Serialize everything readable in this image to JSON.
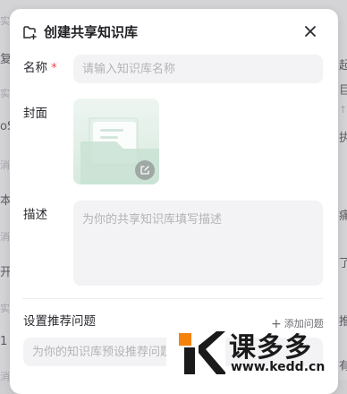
{
  "background": {
    "left_fragments": [
      "实",
      "复",
      "实",
      "oS",
      "消",
      "本",
      "消",
      "开",
      "实",
      "1",
      "消"
    ],
    "right_fragments": [
      "起",
      "巨",
      "↑",
      "执",
      "痛",
      "了",
      "推",
      "有"
    ]
  },
  "dialog": {
    "title": "创建共享知识库",
    "title_icon": "folder-plus-icon",
    "close_icon": "close-icon",
    "name": {
      "label": "名称",
      "required_mark": "*",
      "value": "",
      "placeholder": "请输入知识库名称"
    },
    "cover": {
      "label": "封面",
      "image_icon": "folder-document-icon",
      "edit_icon": "edit-icon"
    },
    "description": {
      "label": "描述",
      "value": "",
      "placeholder": "为你的共享知识库填写描述"
    },
    "recommended_questions": {
      "label": "设置推荐问题",
      "add_icon": "plus-icon",
      "add_label": "添加问题",
      "input_placeholder": "为你的知识库预设推荐问题"
    }
  },
  "watermark": {
    "brand": "课多多",
    "url": "www.kedd.cn",
    "brand_color": "#f5820a"
  }
}
